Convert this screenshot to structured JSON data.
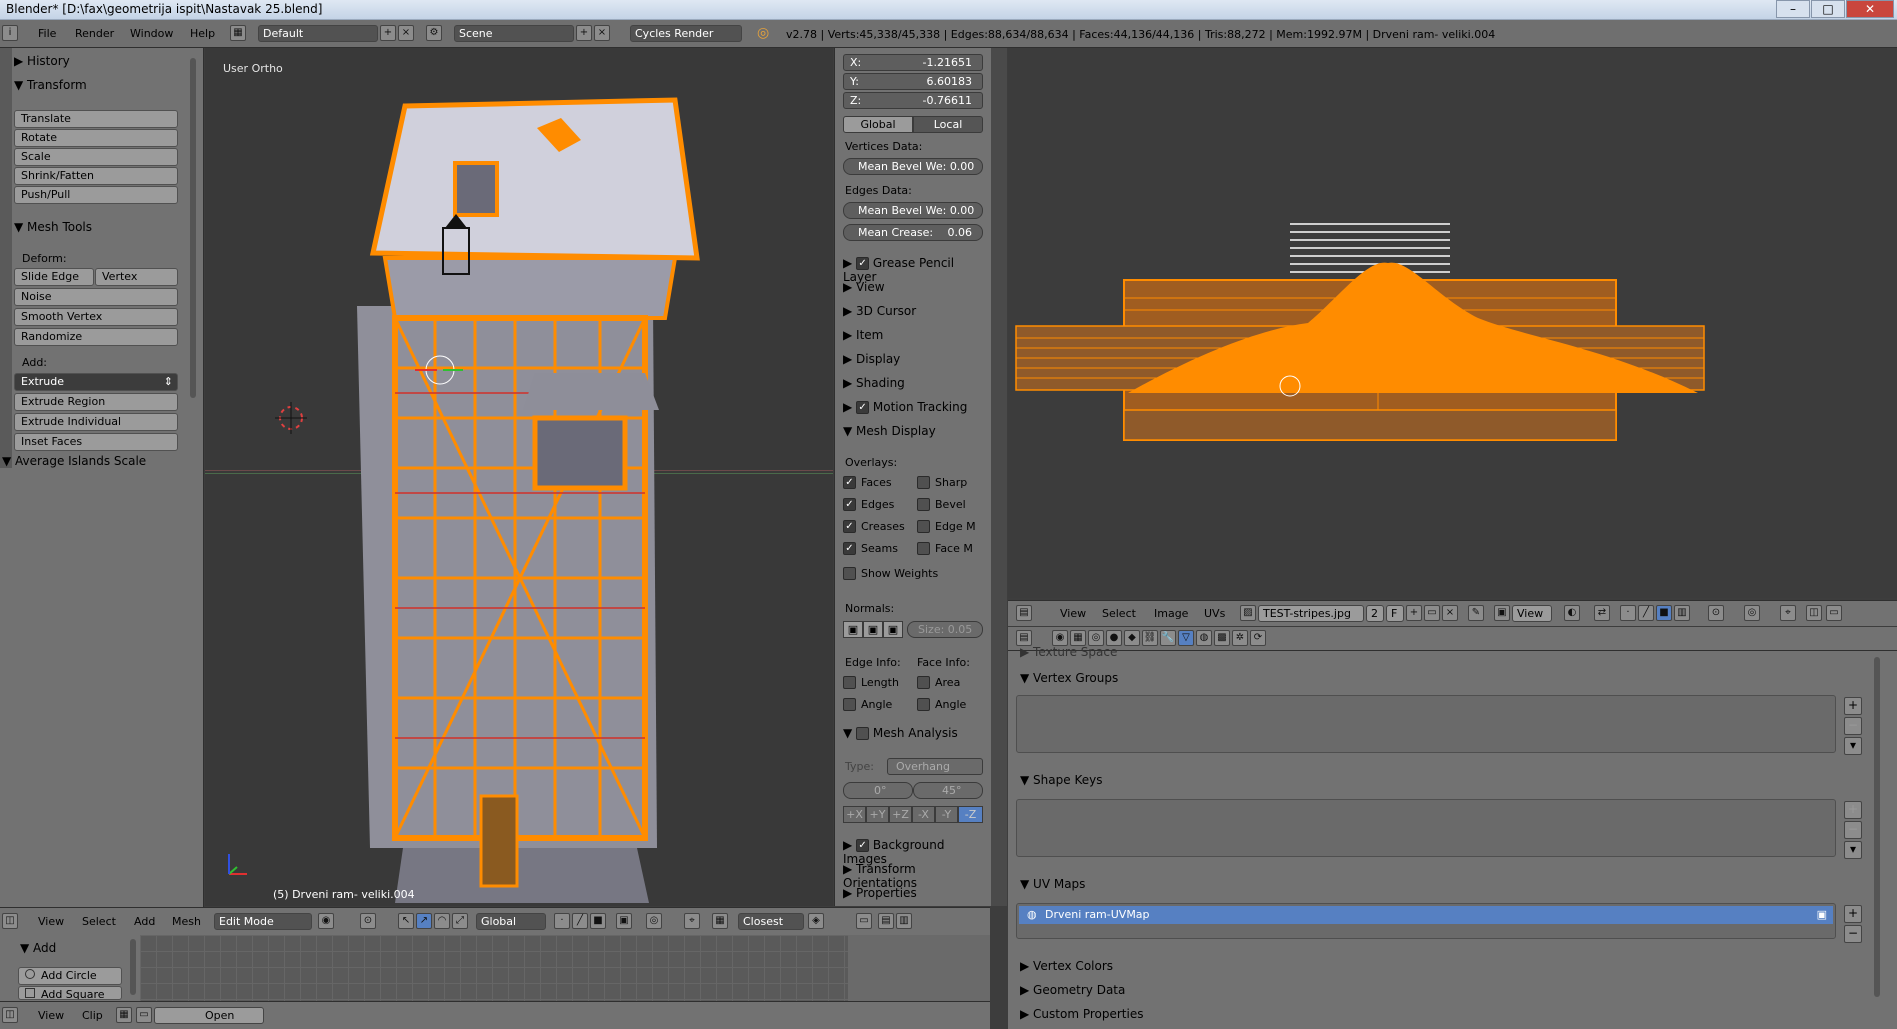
{
  "window": {
    "title": "Blender* [D:\\fax\\geometrija ispit\\Nastavak 25.blend]"
  },
  "infobar": {
    "menus": [
      "File",
      "Render",
      "Window",
      "Help"
    ],
    "layout": "Default",
    "scene": "Scene",
    "engine": "Cycles Render",
    "stats": "v2.78 | Verts:45,338/45,338 | Edges:88,634/88,634 | Faces:44,136/44,136 | Tris:88,272 | Mem:1992.97M | Drveni ram- veliki.004"
  },
  "toolshelf": {
    "history": "History",
    "transform": "Transform",
    "transform_buttons": [
      "Translate",
      "Rotate",
      "Scale",
      "Shrink/Fatten",
      "Push/Pull"
    ],
    "mesh_tools": "Mesh Tools",
    "deform_label": "Deform:",
    "slide_edge": "Slide Edge",
    "vertex": "Vertex",
    "deform_buttons": [
      "Noise",
      "Smooth Vertex",
      "Randomize"
    ],
    "add_label": "Add:",
    "extrude": "Extrude",
    "add_buttons": [
      "Extrude Region",
      "Extrude Individual",
      "Inset Faces"
    ],
    "average_islands": "Average Islands Scale"
  },
  "viewport": {
    "view_label": "User Ortho",
    "object_label": "(5) Drveni ram- veliki.004"
  },
  "npanel": {
    "x_label": "X:",
    "x_value": "-1.21651",
    "y_label": "Y:",
    "y_value": "6.60183",
    "z_label": "Z:",
    "z_value": "-0.76611",
    "global": "Global",
    "local": "Local",
    "vertices_data": "Vertices Data:",
    "mean_bevel_v": "Mean Bevel We: 0.00",
    "edges_data": "Edges Data:",
    "mean_bevel_e": "Mean Bevel We: 0.00",
    "mean_crease": "Mean Crease:",
    "mean_crease_value": "0.06",
    "sections": [
      "Grease Pencil Layer",
      "View",
      "3D Cursor",
      "Item",
      "Display",
      "Shading",
      "Motion Tracking",
      "Mesh Display"
    ],
    "overlays": "Overlays:",
    "ov_left": [
      "Faces",
      "Edges",
      "Creases",
      "Seams"
    ],
    "ov_right": [
      "Sharp",
      "Bevel",
      "Edge M",
      "Face M"
    ],
    "show_weights": "Show Weights",
    "normals": "Normals:",
    "size": "Size: 0.05",
    "edge_info": "Edge Info:",
    "face_info": "Face Info:",
    "length": "Length",
    "area": "Area",
    "angle1": "Angle",
    "angle2": "Angle",
    "mesh_analysis": "Mesh Analysis",
    "type_label": "Type:",
    "type_value": "Overhang",
    "deg0": "0°",
    "deg45": "45°",
    "axes": [
      "+X",
      "+Y",
      "+Z",
      "-X",
      "-Y",
      "-Z"
    ],
    "bottom_sections": [
      "Background Images",
      "Transform Orientations",
      "Properties"
    ]
  },
  "uvheader": {
    "menus": [
      "View",
      "Select",
      "Image",
      "UVs"
    ],
    "image_name": "TEST-stripes.jpg",
    "users": "2",
    "fake": "F",
    "view": "View"
  },
  "props": {
    "texture_space": "Texture Space",
    "vertex_groups": "Vertex Groups",
    "shape_keys": "Shape Keys",
    "uv_maps": "UV Maps",
    "uv_map_name": "Drveni ram-UVMap",
    "vertex_colors": "Vertex Colors",
    "geometry_data": "Geometry Data",
    "custom_properties": "Custom Properties"
  },
  "vpheader": {
    "menus": [
      "View",
      "Select",
      "Add",
      "Mesh"
    ],
    "mode": "Edit Mode",
    "orientation": "Global",
    "snap": "Closest"
  },
  "bottomleft": {
    "add": "Add",
    "add_circle": "Add Circle",
    "add_square": "Add Square"
  },
  "clipheader": {
    "menus": [
      "View",
      "Clip"
    ],
    "open": "Open"
  },
  "colors": {
    "selection_orange": "#ff8c00",
    "panel_gray": "#727272",
    "viewport_bg": "#393939",
    "active_blue": "#5680c2"
  }
}
